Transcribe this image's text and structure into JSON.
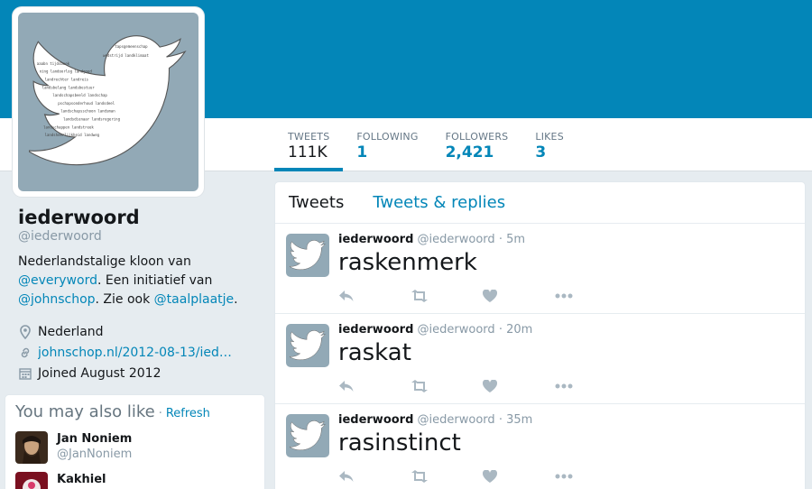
{
  "colors": {
    "banner": "#0386b8",
    "link": "#0386b8",
    "avatar_bg": "#92a9b6"
  },
  "profile": {
    "name": "iederwoord",
    "handle": "@iederwoord",
    "bio": {
      "part1": "Nederlandstalige kloon van ",
      "link1": "@everyword",
      "part2": ". Een initiatief van ",
      "link2": "@johnschop",
      "part3": ". Zie ook ",
      "link3": "@taalplaatje",
      "part4": "."
    },
    "location": "Nederland",
    "website": "johnschop.nl/2012-08-13/ied…",
    "joined": "Joined August 2012"
  },
  "stats": [
    {
      "label": "TWEETS",
      "value": "111K"
    },
    {
      "label": "FOLLOWING",
      "value": "1"
    },
    {
      "label": "FOLLOWERS",
      "value": "2,421"
    },
    {
      "label": "LIKES",
      "value": "3"
    }
  ],
  "tabs": [
    "Tweets",
    "Tweets & replies"
  ],
  "suggestions": {
    "title": "You may also like",
    "separator": "·",
    "refresh": "Refresh",
    "users": [
      {
        "name": "Jan Noniem",
        "handle": "@JanNoniem"
      },
      {
        "name": "Kakhiel",
        "handle": ""
      }
    ]
  },
  "tweets": [
    {
      "name": "iederwoord",
      "handle": "@iederwoord",
      "time": "· 5m",
      "text": "raskenmerk"
    },
    {
      "name": "iederwoord",
      "handle": "@iederwoord",
      "time": "· 20m",
      "text": "raskat"
    },
    {
      "name": "iederwoord",
      "handle": "@iederwoord",
      "time": "· 35m",
      "text": "rasinstinct"
    }
  ],
  "icons": {
    "location": "map-pin-icon",
    "website": "link-icon",
    "joined": "calendar-icon",
    "reply": "reply-icon",
    "retweet": "retweet-icon",
    "like": "heart-icon",
    "more": "more-dots-icon",
    "avatar": "twitter-bird-icon"
  }
}
